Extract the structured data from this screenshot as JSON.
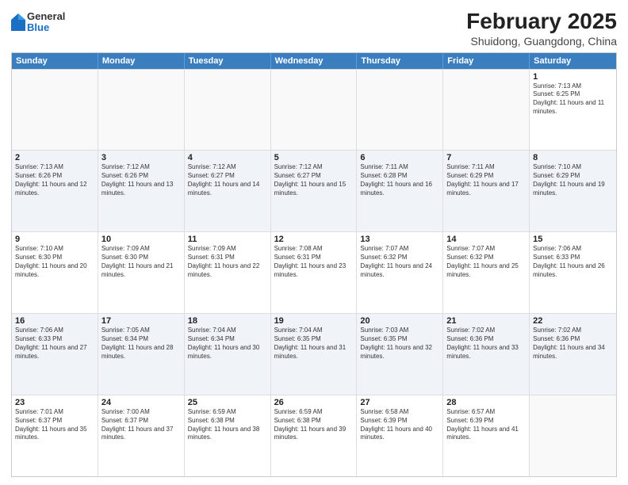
{
  "logo": {
    "general": "General",
    "blue": "Blue"
  },
  "title": "February 2025",
  "subtitle": "Shuidong, Guangdong, China",
  "days": [
    "Sunday",
    "Monday",
    "Tuesday",
    "Wednesday",
    "Thursday",
    "Friday",
    "Saturday"
  ],
  "weeks": [
    [
      {
        "day": "",
        "info": ""
      },
      {
        "day": "",
        "info": ""
      },
      {
        "day": "",
        "info": ""
      },
      {
        "day": "",
        "info": ""
      },
      {
        "day": "",
        "info": ""
      },
      {
        "day": "",
        "info": ""
      },
      {
        "day": "1",
        "info": "Sunrise: 7:13 AM\nSunset: 6:25 PM\nDaylight: 11 hours and 11 minutes."
      }
    ],
    [
      {
        "day": "2",
        "info": "Sunrise: 7:13 AM\nSunset: 6:26 PM\nDaylight: 11 hours and 12 minutes."
      },
      {
        "day": "3",
        "info": "Sunrise: 7:12 AM\nSunset: 6:26 PM\nDaylight: 11 hours and 13 minutes."
      },
      {
        "day": "4",
        "info": "Sunrise: 7:12 AM\nSunset: 6:27 PM\nDaylight: 11 hours and 14 minutes."
      },
      {
        "day": "5",
        "info": "Sunrise: 7:12 AM\nSunset: 6:27 PM\nDaylight: 11 hours and 15 minutes."
      },
      {
        "day": "6",
        "info": "Sunrise: 7:11 AM\nSunset: 6:28 PM\nDaylight: 11 hours and 16 minutes."
      },
      {
        "day": "7",
        "info": "Sunrise: 7:11 AM\nSunset: 6:29 PM\nDaylight: 11 hours and 17 minutes."
      },
      {
        "day": "8",
        "info": "Sunrise: 7:10 AM\nSunset: 6:29 PM\nDaylight: 11 hours and 19 minutes."
      }
    ],
    [
      {
        "day": "9",
        "info": "Sunrise: 7:10 AM\nSunset: 6:30 PM\nDaylight: 11 hours and 20 minutes."
      },
      {
        "day": "10",
        "info": "Sunrise: 7:09 AM\nSunset: 6:30 PM\nDaylight: 11 hours and 21 minutes."
      },
      {
        "day": "11",
        "info": "Sunrise: 7:09 AM\nSunset: 6:31 PM\nDaylight: 11 hours and 22 minutes."
      },
      {
        "day": "12",
        "info": "Sunrise: 7:08 AM\nSunset: 6:31 PM\nDaylight: 11 hours and 23 minutes."
      },
      {
        "day": "13",
        "info": "Sunrise: 7:07 AM\nSunset: 6:32 PM\nDaylight: 11 hours and 24 minutes."
      },
      {
        "day": "14",
        "info": "Sunrise: 7:07 AM\nSunset: 6:32 PM\nDaylight: 11 hours and 25 minutes."
      },
      {
        "day": "15",
        "info": "Sunrise: 7:06 AM\nSunset: 6:33 PM\nDaylight: 11 hours and 26 minutes."
      }
    ],
    [
      {
        "day": "16",
        "info": "Sunrise: 7:06 AM\nSunset: 6:33 PM\nDaylight: 11 hours and 27 minutes."
      },
      {
        "day": "17",
        "info": "Sunrise: 7:05 AM\nSunset: 6:34 PM\nDaylight: 11 hours and 28 minutes."
      },
      {
        "day": "18",
        "info": "Sunrise: 7:04 AM\nSunset: 6:34 PM\nDaylight: 11 hours and 30 minutes."
      },
      {
        "day": "19",
        "info": "Sunrise: 7:04 AM\nSunset: 6:35 PM\nDaylight: 11 hours and 31 minutes."
      },
      {
        "day": "20",
        "info": "Sunrise: 7:03 AM\nSunset: 6:35 PM\nDaylight: 11 hours and 32 minutes."
      },
      {
        "day": "21",
        "info": "Sunrise: 7:02 AM\nSunset: 6:36 PM\nDaylight: 11 hours and 33 minutes."
      },
      {
        "day": "22",
        "info": "Sunrise: 7:02 AM\nSunset: 6:36 PM\nDaylight: 11 hours and 34 minutes."
      }
    ],
    [
      {
        "day": "23",
        "info": "Sunrise: 7:01 AM\nSunset: 6:37 PM\nDaylight: 11 hours and 35 minutes."
      },
      {
        "day": "24",
        "info": "Sunrise: 7:00 AM\nSunset: 6:37 PM\nDaylight: 11 hours and 37 minutes."
      },
      {
        "day": "25",
        "info": "Sunrise: 6:59 AM\nSunset: 6:38 PM\nDaylight: 11 hours and 38 minutes."
      },
      {
        "day": "26",
        "info": "Sunrise: 6:59 AM\nSunset: 6:38 PM\nDaylight: 11 hours and 39 minutes."
      },
      {
        "day": "27",
        "info": "Sunrise: 6:58 AM\nSunset: 6:39 PM\nDaylight: 11 hours and 40 minutes."
      },
      {
        "day": "28",
        "info": "Sunrise: 6:57 AM\nSunset: 6:39 PM\nDaylight: 11 hours and 41 minutes."
      },
      {
        "day": "",
        "info": ""
      }
    ]
  ]
}
